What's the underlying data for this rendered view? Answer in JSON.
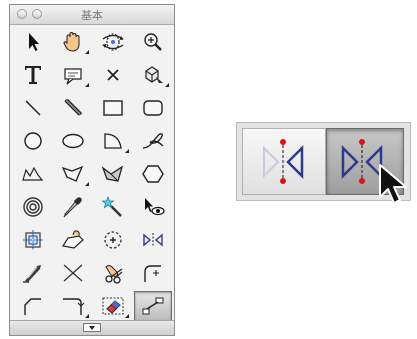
{
  "palette": {
    "title": "基本",
    "tools": [
      {
        "name": "arrow-icon"
      },
      {
        "name": "hand-icon"
      },
      {
        "name": "rotate-view-icon"
      },
      {
        "name": "zoom-icon"
      },
      {
        "name": "text-icon"
      },
      {
        "name": "text-frame-icon"
      },
      {
        "name": "x-icon"
      },
      {
        "name": "3d-shape-icon"
      },
      {
        "name": "line-icon"
      },
      {
        "name": "double-line-icon"
      },
      {
        "name": "rectangle-icon"
      },
      {
        "name": "rounded-rectangle-icon"
      },
      {
        "name": "circle-icon"
      },
      {
        "name": "ellipse-icon"
      },
      {
        "name": "arc-icon"
      },
      {
        "name": "freehand-icon"
      },
      {
        "name": "polyline-icon"
      },
      {
        "name": "polygon-icon"
      },
      {
        "name": "filled-polygon-icon"
      },
      {
        "name": "hexagon-icon"
      },
      {
        "name": "spiral-icon"
      },
      {
        "name": "eyedropper-icon"
      },
      {
        "name": "magic-wand-icon"
      },
      {
        "name": "eye-pointer-icon"
      },
      {
        "name": "crop-icon"
      },
      {
        "name": "pick-icon"
      },
      {
        "name": "center-point-icon"
      },
      {
        "name": "mirror-icon"
      },
      {
        "name": "knife-icon"
      },
      {
        "name": "split-icon"
      },
      {
        "name": "scissors-hand-icon"
      },
      {
        "name": "fillet-icon"
      },
      {
        "name": "chamfer-icon"
      },
      {
        "name": "offset-corner-icon"
      },
      {
        "name": "eraser-icon"
      },
      {
        "name": "connector-icon"
      }
    ],
    "active_index": 35
  },
  "zoom_panel": {
    "buttons": [
      {
        "name": "mirror-option-1"
      },
      {
        "name": "mirror-option-2"
      }
    ],
    "selected": 1
  },
  "colors": {
    "accent_red": "#e0101a",
    "mirror_blue": "#2c3a8c"
  }
}
